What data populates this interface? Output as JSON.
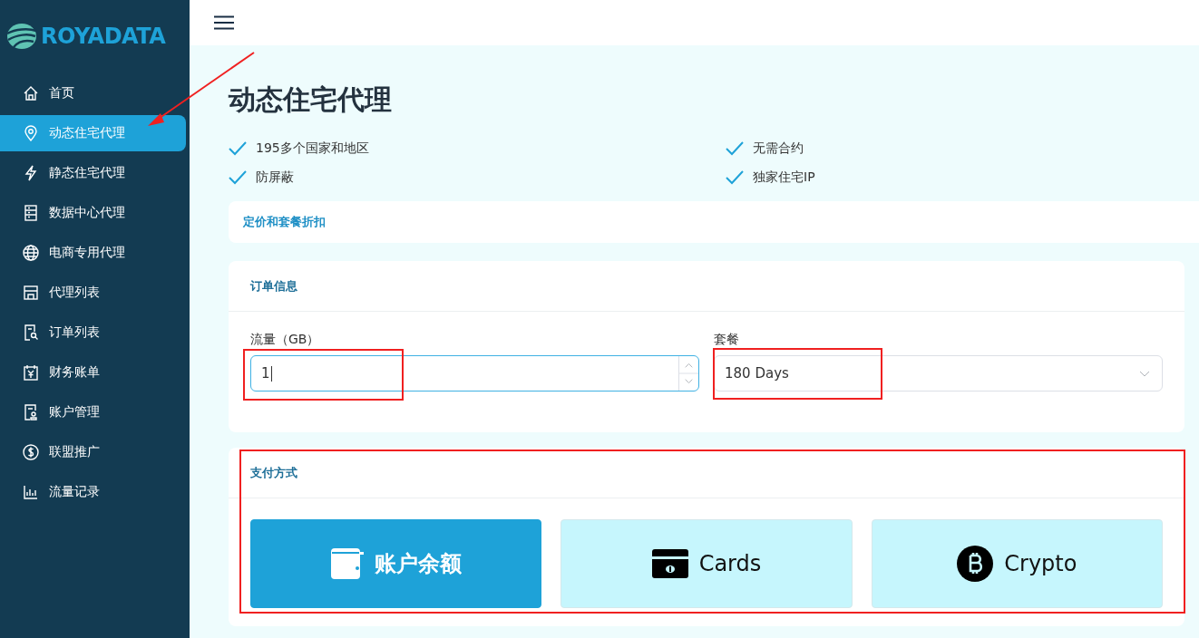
{
  "brand": {
    "name": "ROYADATA"
  },
  "sidebar": {
    "items": [
      {
        "label": "首页",
        "selected": false
      },
      {
        "label": "动态住宅代理",
        "selected": true
      },
      {
        "label": "静态住宅代理",
        "selected": false
      },
      {
        "label": "数据中心代理",
        "selected": false
      },
      {
        "label": "电商专用代理",
        "selected": false
      },
      {
        "label": "代理列表",
        "selected": false
      },
      {
        "label": "订单列表",
        "selected": false
      },
      {
        "label": "财务账单",
        "selected": false
      },
      {
        "label": "账户管理",
        "selected": false
      },
      {
        "label": "联盟推广",
        "selected": false
      },
      {
        "label": "流量记录",
        "selected": false
      }
    ]
  },
  "page": {
    "title": "动态住宅代理",
    "features": [
      "195多个国家和地区",
      "无需合约",
      "防屏蔽",
      "独家住宅IP"
    ],
    "pricing_link": "定价和套餐折扣"
  },
  "order": {
    "title": "订单信息",
    "fields": [
      {
        "kind": "number",
        "label": "流量（GB）",
        "value": "1",
        "highlighted": true
      },
      {
        "kind": "select",
        "label": "套餐",
        "value": "180 Days",
        "highlighted": true
      }
    ]
  },
  "payment": {
    "title": "支付方式",
    "highlighted": true,
    "methods": [
      {
        "label": "账户余额",
        "selected": true
      },
      {
        "label": "Cards",
        "selected": false
      },
      {
        "label": "Crypto",
        "selected": false
      }
    ]
  }
}
